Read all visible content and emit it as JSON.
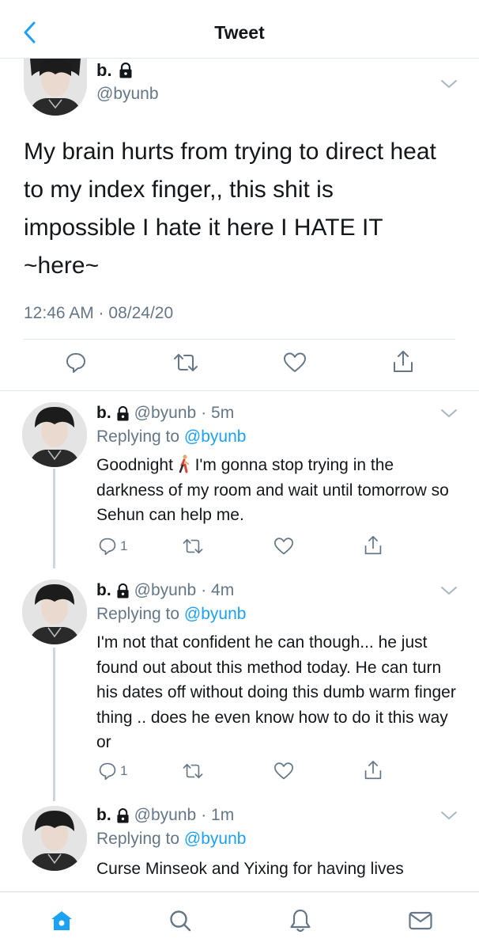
{
  "header": {
    "title": "Tweet",
    "back_icon": "chevron-left-icon"
  },
  "main_tweet": {
    "name": "b.",
    "handle": "@byunb",
    "text": "My brain hurts from trying to direct heat to my index finger,, this shit is impossible I hate it here I HATE IT ~here~",
    "timestamp": "12:46 AM · 08/24/20"
  },
  "replies": [
    {
      "name": "b.",
      "handle": "@byunb",
      "time": "· 5m",
      "replying_label": "Replying to",
      "replying_to": "@byunb",
      "text_before_emoji": "Goodnight ",
      "text_after_emoji": " I'm gonna stop trying in the darkness of my room and wait until tomorrow so Sehun can help me.",
      "reply_count": "1"
    },
    {
      "name": "b.",
      "handle": "@byunb",
      "time": "· 4m",
      "replying_label": "Replying to",
      "replying_to": "@byunb",
      "text": "I'm not that confident he can though... he just found out about this method today. He can turn his dates off without doing this dumb warm finger thing .. does he even know how to do it this way or",
      "reply_count": "1"
    },
    {
      "name": "b.",
      "handle": "@byunb",
      "time": "· 1m",
      "replying_label": "Replying to",
      "replying_to": "@byunb",
      "text": "Curse Minseok and Yixing for having lives"
    }
  ],
  "colors": {
    "accent": "#1da1f2",
    "secondary_text": "#657786",
    "primary_text": "#14171a",
    "divider": "#e1e8ed"
  },
  "nav": {
    "items": [
      "home-icon",
      "search-icon",
      "notifications-icon",
      "messages-icon"
    ],
    "active": "home-icon"
  }
}
